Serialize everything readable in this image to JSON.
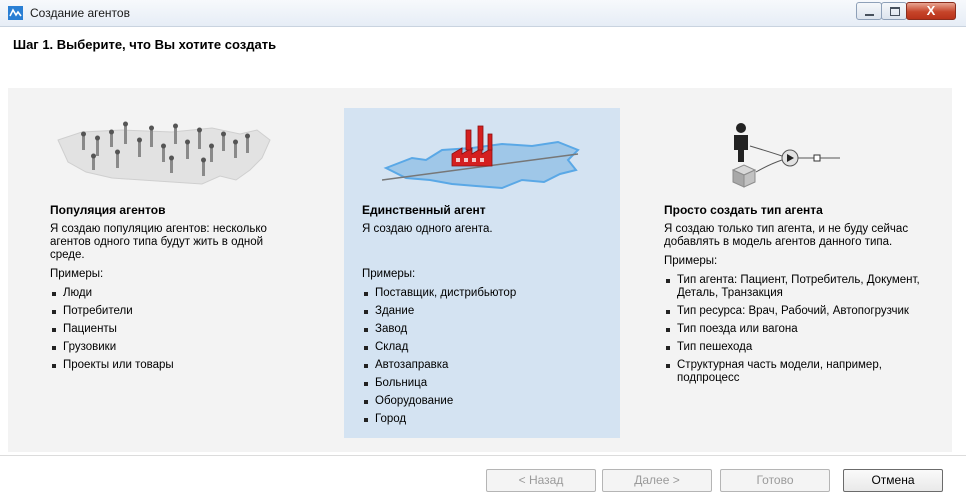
{
  "window": {
    "title": "Создание агентов",
    "close_label": "X"
  },
  "step_title": "Шаг 1. Выберите, что Вы хотите создать",
  "options": [
    {
      "title": "Популяция агентов",
      "description": "Я создаю популяцию агентов: несколько агентов одного типа будут жить в одной среде.",
      "examples_label": "Примеры:",
      "examples": [
        "Люди",
        "Потребители",
        "Пациенты",
        "Грузовики",
        "Проекты или товары"
      ],
      "icon": "population-map-icon"
    },
    {
      "title": "Единственный агент",
      "description": "Я создаю одного агента.",
      "examples_label": "Примеры:",
      "examples": [
        "Поставщик, дистрибьютор",
        "Здание",
        "Завод",
        "Склад",
        "Автозаправка",
        "Больница",
        "Оборудование",
        "Город"
      ],
      "icon": "factory-map-icon",
      "selected": true
    },
    {
      "title": "Просто создать тип агента",
      "description": "Я создаю только тип агента, и не буду сейчас добавлять в модель агентов данного типа.",
      "examples_label": "Примеры:",
      "examples": [
        "Тип агента: Пациент, Потребитель, Документ, Деталь, Транзакция",
        "Тип ресурса: Врач, Рабочий, Автопогрузчик",
        "Тип поезда или вагона",
        "Тип пешехода",
        "Структурная часть модели, например, подпроцесс"
      ],
      "icon": "agent-type-icon"
    }
  ],
  "buttons": {
    "back": "< Назад",
    "next": "Далее >",
    "finish": "Готово",
    "cancel": "Отмена"
  },
  "colors": {
    "selected_bg": "#d4e3f2",
    "content_bg": "#f3f3f3",
    "factory_red": "#d41f1f"
  }
}
